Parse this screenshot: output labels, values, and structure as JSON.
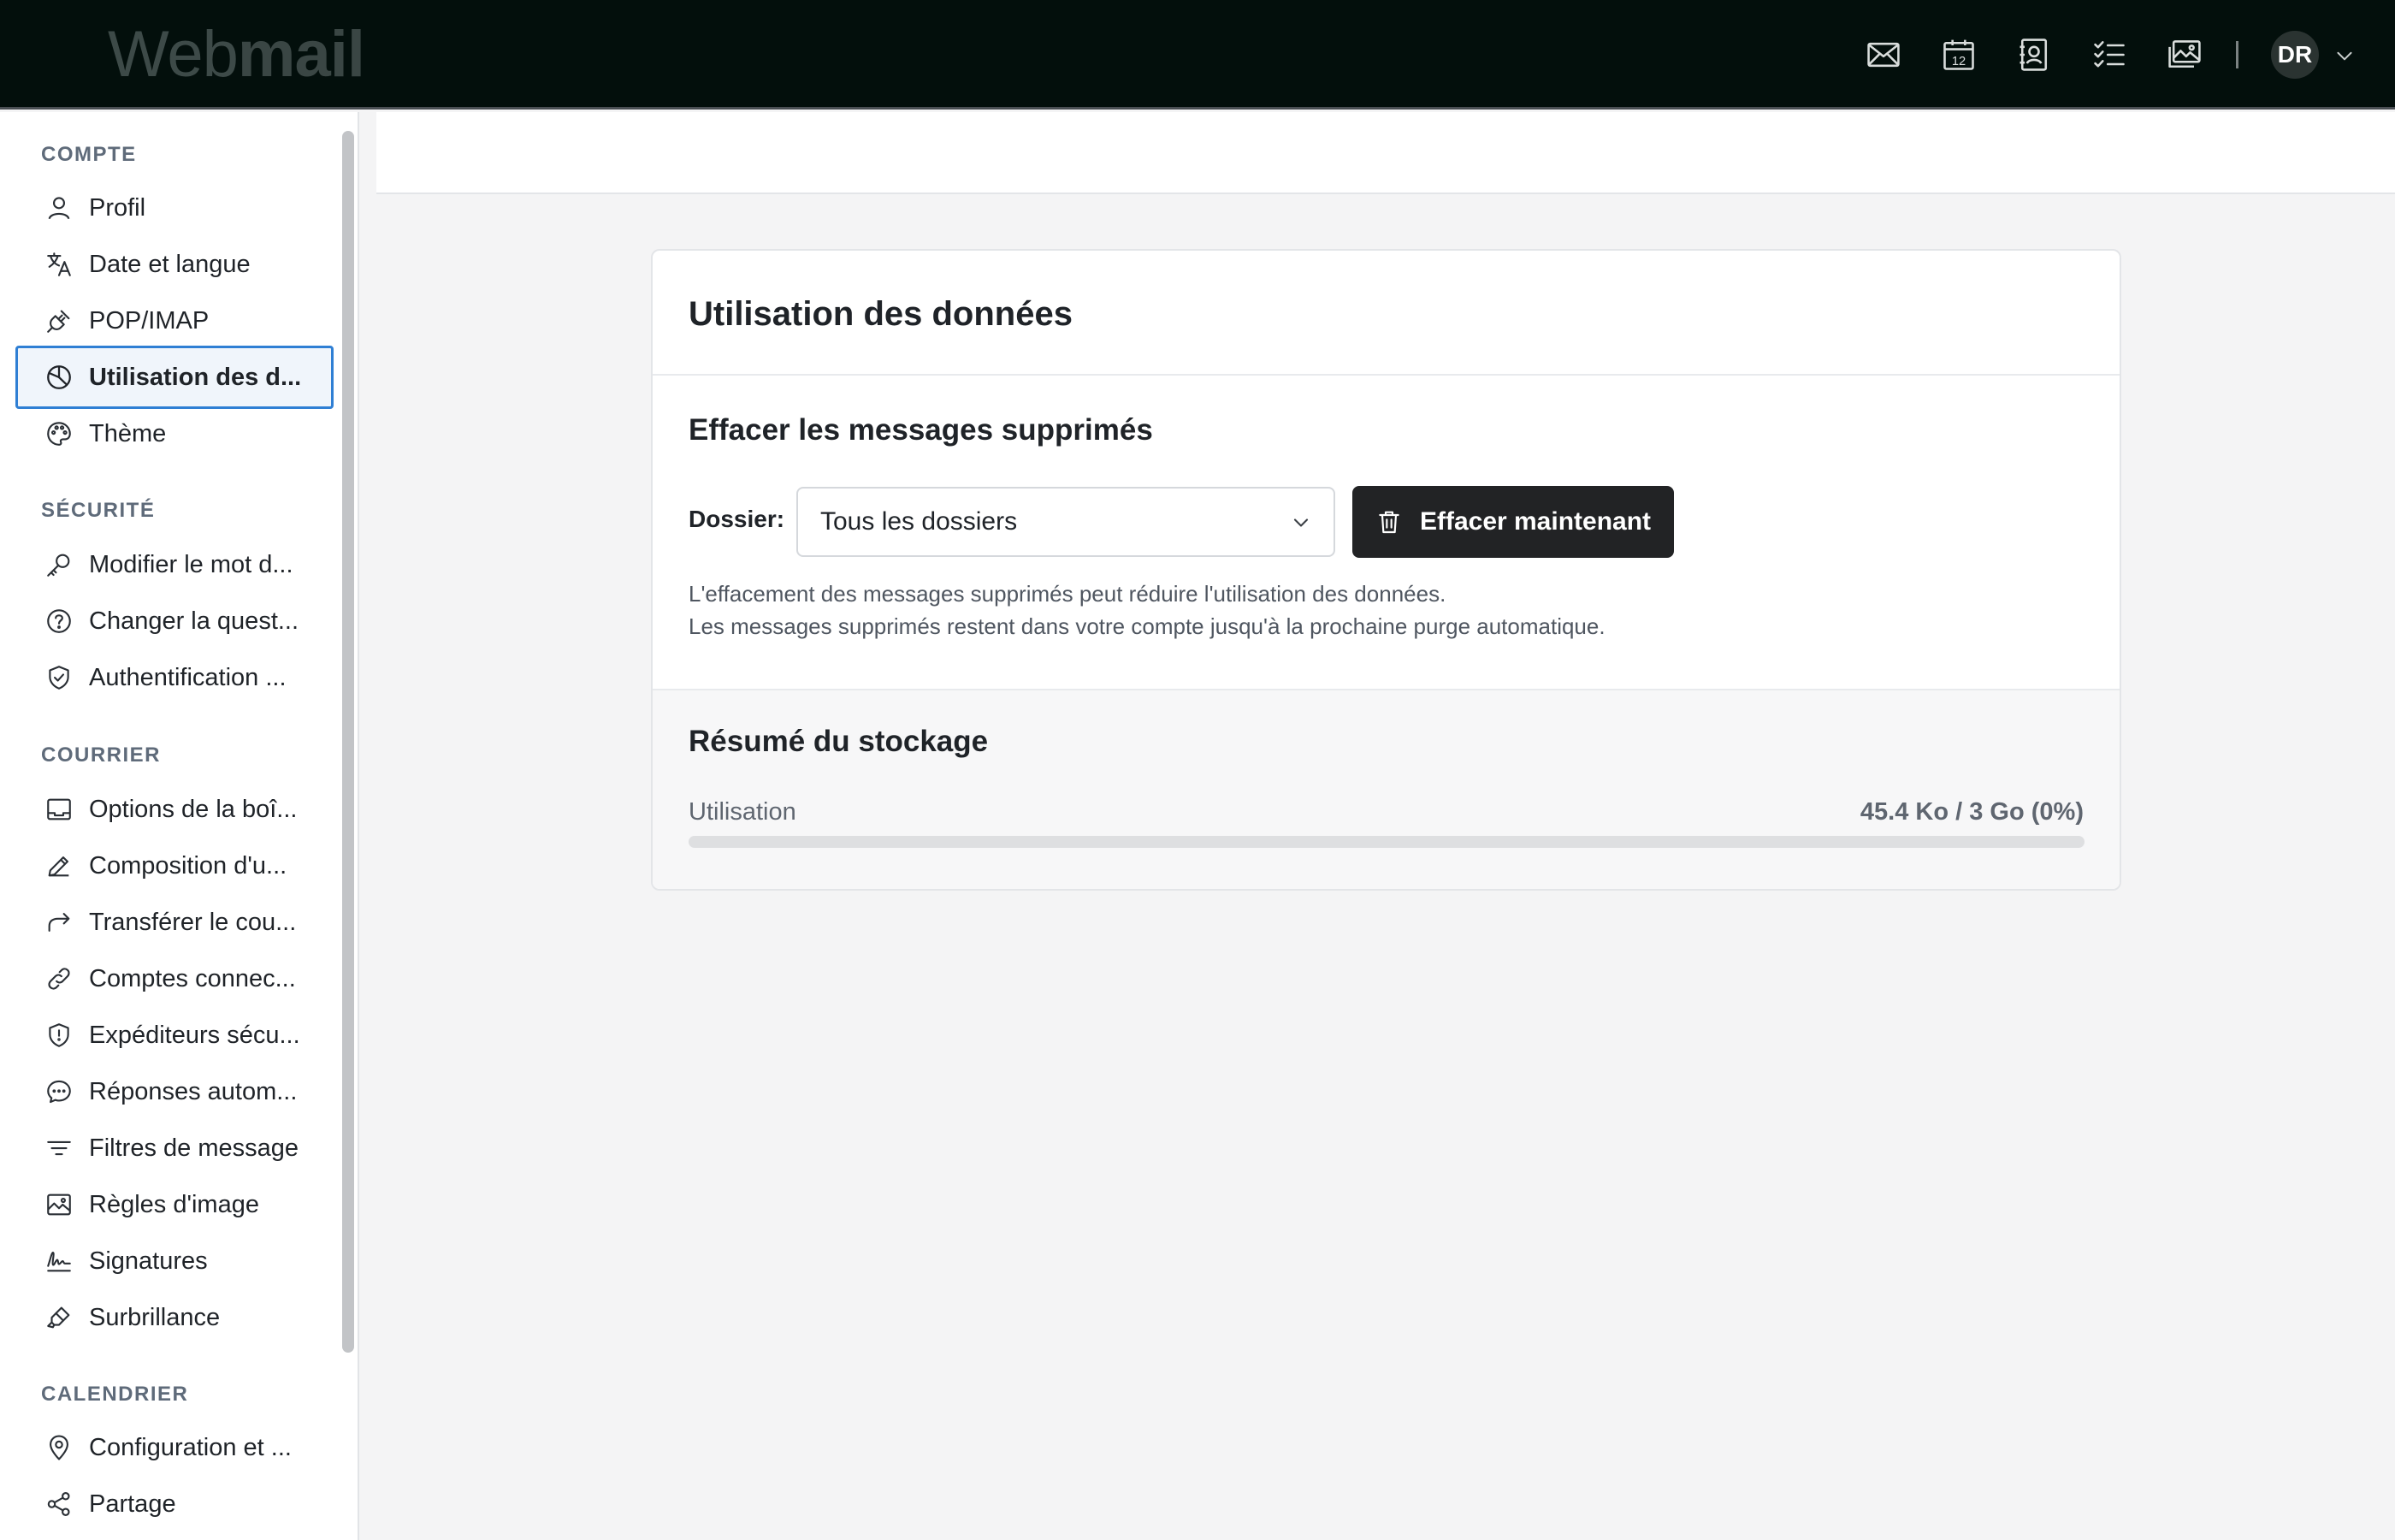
{
  "app": {
    "logo_web": "Web",
    "logo_mail": "mail"
  },
  "topbar": {
    "icons": [
      "mail-icon",
      "calendar-icon",
      "contacts-icon",
      "tasks-icon",
      "photos-icon"
    ],
    "calendar_day": "12",
    "avatar_initials": "DR"
  },
  "sidebar": {
    "sections": [
      {
        "label": "COMPTE",
        "items": [
          {
            "label": "Profil",
            "icon": "user-icon"
          },
          {
            "label": "Date et langue",
            "icon": "translate-icon"
          },
          {
            "label": "POP/IMAP",
            "icon": "plug-icon"
          },
          {
            "label": "Utilisation des d...",
            "icon": "pie-chart-icon",
            "active": true
          },
          {
            "label": "Thème",
            "icon": "palette-icon"
          }
        ]
      },
      {
        "label": "SÉCURITÉ",
        "items": [
          {
            "label": "Modifier le mot d...",
            "icon": "key-icon"
          },
          {
            "label": "Changer la quest...",
            "icon": "question-circle-icon"
          },
          {
            "label": "Authentification ...",
            "icon": "shield-check-icon"
          }
        ]
      },
      {
        "label": "COURRIER",
        "items": [
          {
            "label": "Options de la boî...",
            "icon": "inbox-icon"
          },
          {
            "label": "Composition d'u...",
            "icon": "pencil-icon"
          },
          {
            "label": "Transférer le cou...",
            "icon": "forward-arrow-icon"
          },
          {
            "label": "Comptes connec...",
            "icon": "link-icon"
          },
          {
            "label": "Expéditeurs sécu...",
            "icon": "shield-alert-icon"
          },
          {
            "label": "Réponses autom...",
            "icon": "chat-bubble-icon"
          },
          {
            "label": "Filtres de message",
            "icon": "filter-icon"
          },
          {
            "label": "Règles d'image",
            "icon": "image-icon"
          },
          {
            "label": "Signatures",
            "icon": "signature-icon"
          },
          {
            "label": "Surbrillance",
            "icon": "highlighter-icon"
          }
        ]
      },
      {
        "label": "CALENDRIER",
        "items": [
          {
            "label": "Configuration et ...",
            "icon": "map-pin-icon"
          },
          {
            "label": "Partage",
            "icon": "share-icon"
          }
        ]
      }
    ]
  },
  "main": {
    "card_title": "Utilisation des données",
    "purge": {
      "title": "Effacer les messages supprimés",
      "folder_label": "Dossier:",
      "folder_value": "Tous les dossiers",
      "button_label": "Effacer maintenant",
      "help_line1": "L'effacement des messages supprimés peut réduire l'utilisation des données.",
      "help_line2": "Les messages supprimés restent dans votre compte jusqu'à la prochaine purge automatique."
    },
    "storage": {
      "title": "Résumé du stockage",
      "usage_label": "Utilisation",
      "usage_value": "45.4 Ko / 3 Go (0%)",
      "usage_fraction": 0
    }
  },
  "colors": {
    "accent": "#2f7fd4",
    "topbar": "#030f0c",
    "button": "#222325"
  }
}
